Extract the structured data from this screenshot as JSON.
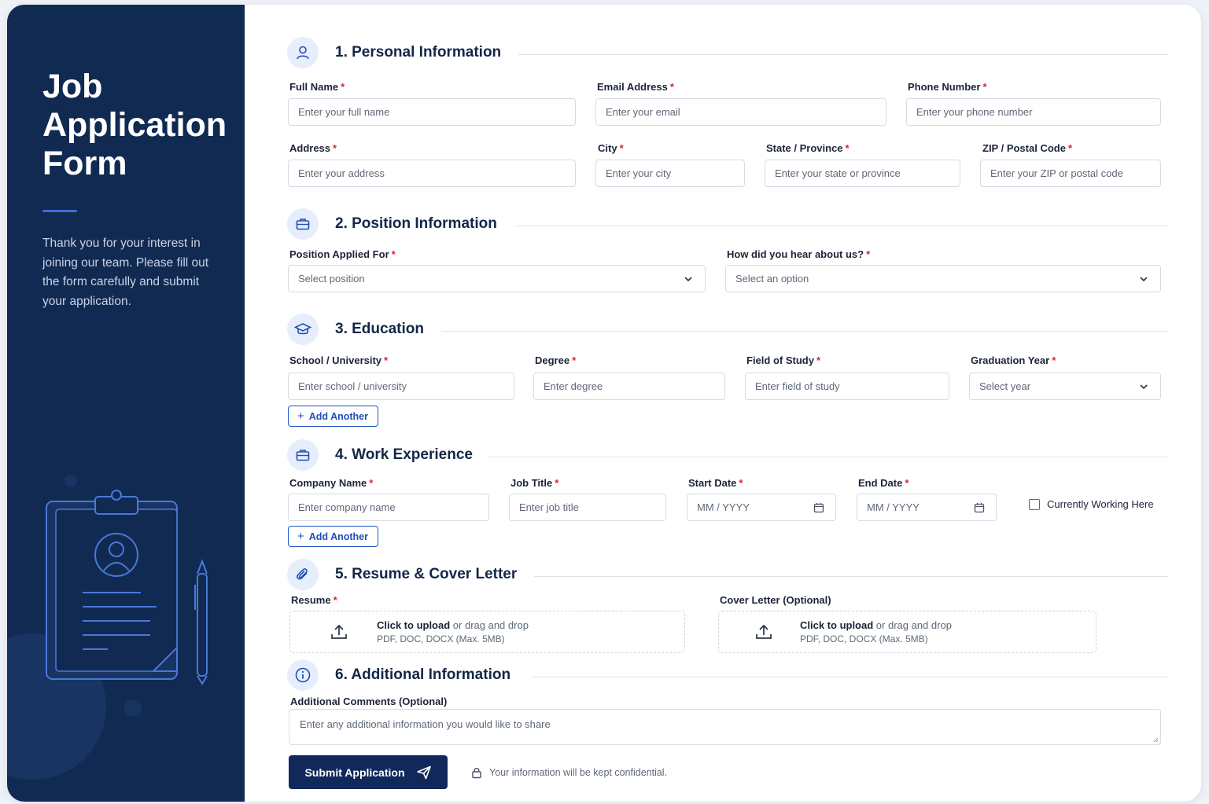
{
  "sidebar": {
    "title_lines": [
      "Job",
      "Application",
      "Form"
    ],
    "intro": "Thank you for your interest in joining our team. Please fill out the form carefully and submit your application."
  },
  "sections": {
    "personal": {
      "title": "1.  Personal Information",
      "full_name": {
        "label": "Full Name",
        "placeholder": "Enter your full name"
      },
      "email": {
        "label": "Email Address",
        "placeholder": "Enter your email"
      },
      "phone": {
        "label": "Phone Number",
        "placeholder": "Enter your phone number"
      },
      "address": {
        "label": "Address",
        "placeholder": "Enter your address"
      },
      "city": {
        "label": "City",
        "placeholder": "Enter your city"
      },
      "state": {
        "label": "State / Province",
        "placeholder": "Enter your state or province"
      },
      "zip": {
        "label": "ZIP / Postal Code",
        "placeholder": "Enter your ZIP or postal code"
      }
    },
    "position": {
      "title": "2.  Position Information",
      "position": {
        "label": "Position Applied For",
        "placeholder": "Select position"
      },
      "source": {
        "label": "How did you hear about us?",
        "placeholder": "Select an option"
      }
    },
    "education": {
      "title": "3.  Education",
      "school": {
        "label": "School / University",
        "placeholder": "Enter school / university"
      },
      "degree": {
        "label": "Degree",
        "placeholder": "Enter degree"
      },
      "field": {
        "label": "Field of Study",
        "placeholder": "Enter field of study"
      },
      "year": {
        "label": "Graduation Year",
        "placeholder": "Select year"
      },
      "add_label": "Add Another"
    },
    "work": {
      "title": "4.  Work Experience",
      "company": {
        "label": "Company Name",
        "placeholder": "Enter company name"
      },
      "job_title": {
        "label": "Job Title",
        "placeholder": "Enter job title"
      },
      "start": {
        "label": "Start Date",
        "placeholder": "MM / YYYY"
      },
      "end": {
        "label": "End Date",
        "placeholder": "MM / YYYY"
      },
      "current_label": "Currently Working Here",
      "add_label": "Add Another"
    },
    "resume": {
      "title": "5.  Resume & Cover Letter",
      "resume_label": "Resume",
      "cover_label": "Cover Letter (Optional)",
      "click_text": "Click to upload",
      "drag_text": "or drag and drop",
      "formats": "PDF, DOC, DOCX (Max. 5MB)"
    },
    "additional": {
      "title": "6.  Additional Information",
      "comments_label": "Additional Comments (Optional)",
      "comments_placeholder": "Enter any additional information you would like to share"
    }
  },
  "required_mark": "*",
  "submit_label": "Submit Application",
  "confidential_note": "Your information will be kept confidential.",
  "colors": {
    "sidebar": "#112a52",
    "accent": "#1f55c7",
    "required": "#d6243a",
    "submit": "#10295a"
  }
}
